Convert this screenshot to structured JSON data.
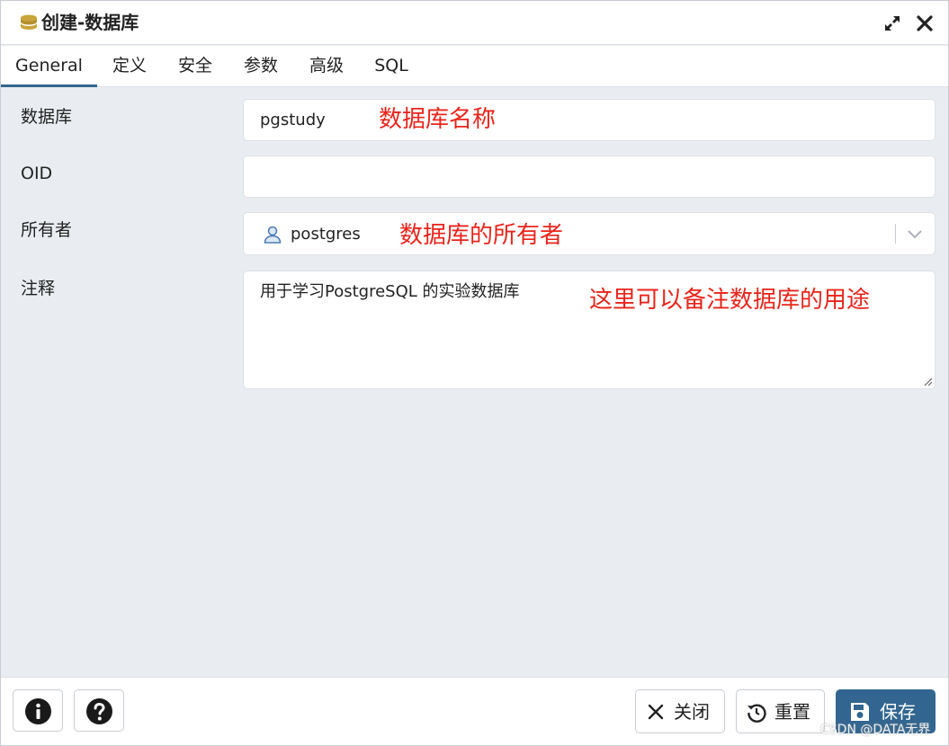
{
  "window": {
    "title": "创建-数据库"
  },
  "tabs": [
    {
      "label": "General",
      "active": true
    },
    {
      "label": "定义",
      "active": false
    },
    {
      "label": "安全",
      "active": false
    },
    {
      "label": "参数",
      "active": false
    },
    {
      "label": "高级",
      "active": false
    },
    {
      "label": "SQL",
      "active": false
    }
  ],
  "form": {
    "database": {
      "label": "数据库",
      "value": "pgstudy"
    },
    "oid": {
      "label": "OID",
      "value": ""
    },
    "owner": {
      "label": "所有者",
      "value": "postgres"
    },
    "comment": {
      "label": "注释",
      "value": "用于学习PostgreSQL 的实验数据库"
    }
  },
  "annotations": {
    "database": "数据库名称",
    "owner": "数据库的所有者",
    "comment": "这里可以备注数据库的用途"
  },
  "footer": {
    "info_icon": "info-icon",
    "help_icon": "help-icon",
    "close_label": "关闭",
    "reset_label": "重置",
    "save_label": "保存"
  },
  "watermark": "CSDN @DATA无界",
  "colors": {
    "accent": "#326690",
    "annotation": "#e8241b",
    "background": "#e9edf2"
  }
}
